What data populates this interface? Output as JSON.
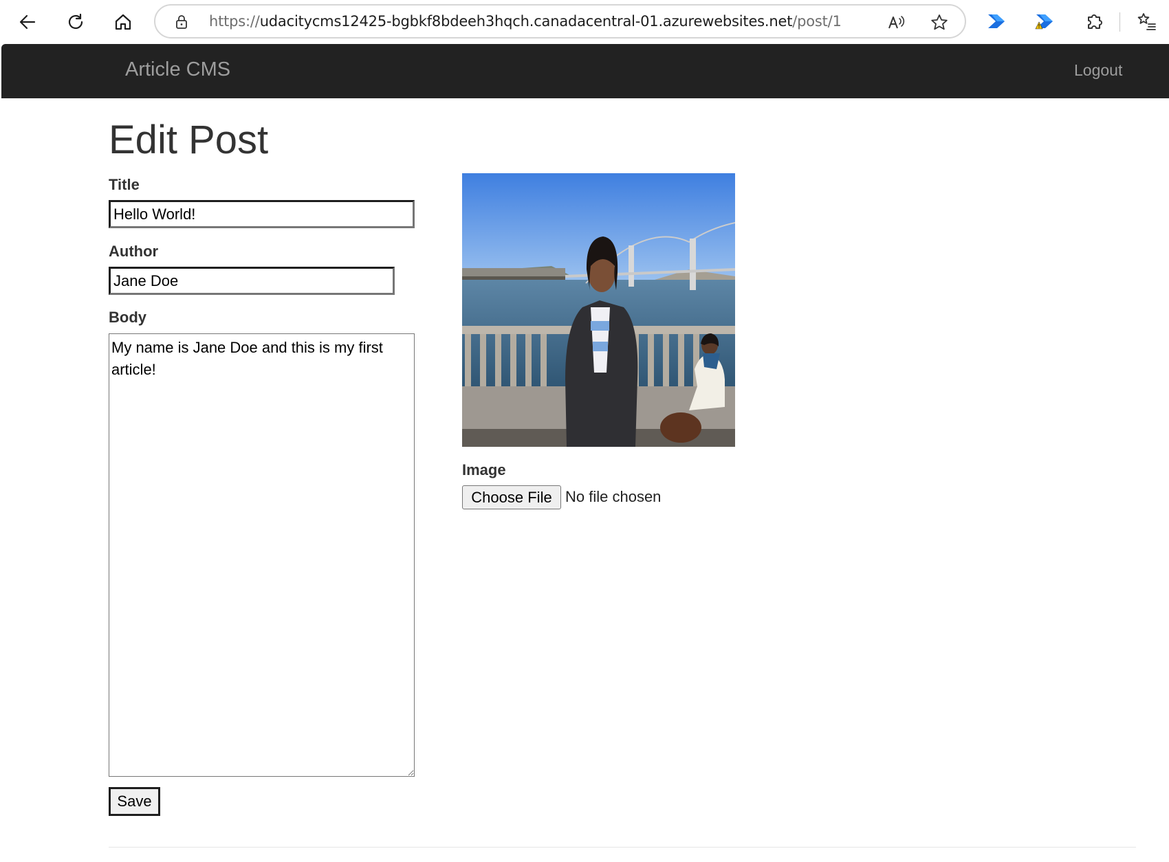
{
  "browser": {
    "url_prefix": "https://",
    "url_host": "udacitycms12425-bgbkf8bdeeh3hqch.canadacentral-01.azurewebsites.net",
    "url_path": "/post/1"
  },
  "navbar": {
    "brand": "Article CMS",
    "logout": "Logout",
    "background": "#222222",
    "text_color": "#9d9d9d"
  },
  "form": {
    "heading": "Edit Post",
    "title_label": "Title",
    "title_value": "Hello World!",
    "author_label": "Author",
    "author_value": "Jane Doe",
    "body_label": "Body",
    "body_value": "My name is Jane Doe and this is my first article!",
    "save_label": "Save",
    "image_label": "Image",
    "file_button_label": "Choose File",
    "file_status": "No file chosen"
  }
}
